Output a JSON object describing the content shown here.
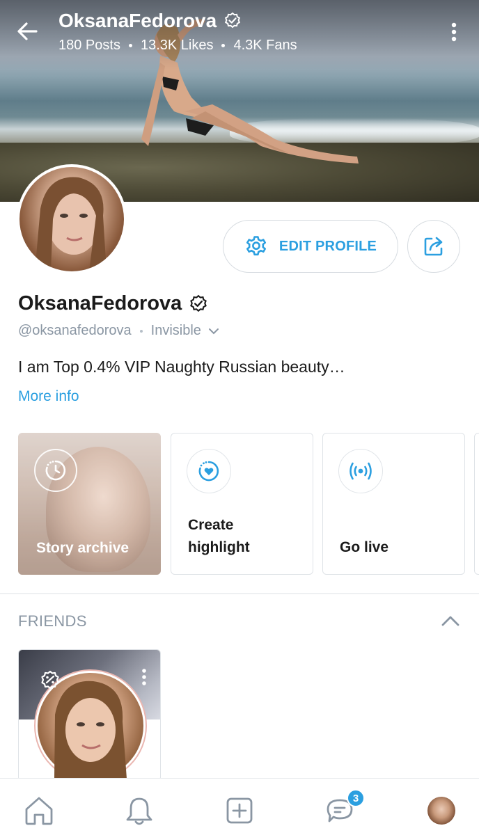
{
  "header": {
    "title": "OksanaFedorova",
    "posts": "180 Posts",
    "likes": "13.3K Likes",
    "fans": "4.3K Fans"
  },
  "profile": {
    "name": "OksanaFedorova",
    "handle": "@oksanafedorova",
    "status": "Invisible",
    "bio": "I am Top 0.4% VIP Naughty Russian beauty…",
    "more_info": "More info",
    "edit_profile_label": "EDIT PROFILE"
  },
  "cards": {
    "story_archive": "Story archive",
    "create_highlight_line1": "Create",
    "create_highlight_line2": "highlight",
    "go_live": "Go live"
  },
  "friends": {
    "title": "FRIENDS"
  },
  "nav": {
    "messages_badge": "3"
  },
  "colors": {
    "accent": "#2b9fe0",
    "muted": "#8a96a3",
    "border": "#dfe3e7"
  },
  "icons": [
    "arrow-left-icon",
    "verified-icon",
    "kebab-icon",
    "gear-icon",
    "share-icon",
    "chevron-down-icon",
    "clock-icon",
    "heart-circle-icon",
    "broadcast-icon",
    "chevron-up-icon",
    "promo-icon",
    "home-icon",
    "bell-icon",
    "plus-square-icon",
    "chat-icon"
  ]
}
